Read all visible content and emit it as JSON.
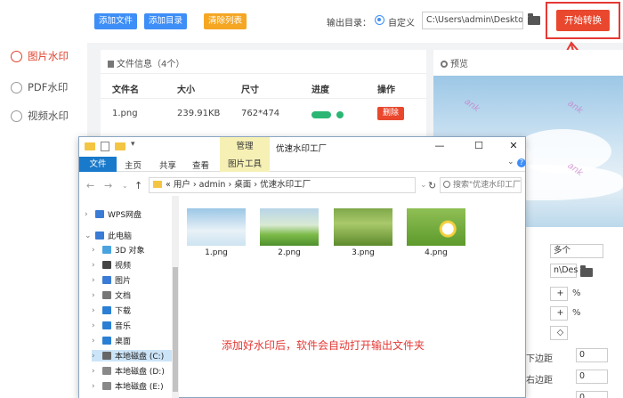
{
  "nav": {
    "items": [
      {
        "label": "图片水印",
        "active": true
      },
      {
        "label": "PDF水印",
        "active": false
      },
      {
        "label": "视频水印",
        "active": false
      }
    ]
  },
  "toolbar": {
    "add_file": "添加文件",
    "add_dir": "添加目录",
    "clear_list": "清除列表",
    "output_label": "输出目录：",
    "custom_label": "自定义",
    "output_path": "C:\\Users\\admin\\Deskto",
    "start_button": "开始转换"
  },
  "file_panel": {
    "title": "文件信息（4个）",
    "headers": [
      "文件名",
      "大小",
      "尺寸",
      "进度",
      "操作"
    ],
    "rows": [
      {
        "name": "1.png",
        "size": "239.91KB",
        "dimensions": "762*474",
        "action": "删除"
      }
    ]
  },
  "preview": {
    "title": "预览",
    "watermark_text": "ank",
    "count_value": "多个",
    "path_value": "n\\Des",
    "percent1": "%",
    "percent2": "%",
    "margin_label1": "下边距",
    "margin_label2": "右边距",
    "zero1": "0",
    "zero2": "0",
    "zero3": "0"
  },
  "explorer": {
    "manage_tab": "管理",
    "title": "优速水印工厂",
    "ribbon_tabs": [
      "文件",
      "主页",
      "共享",
      "查看"
    ],
    "picture_tools": "图片工具",
    "address": "«  用户  ›  admin  ›  桌面  ›  优速水印工厂",
    "search_placeholder": "搜索\"优速水印工厂\"",
    "tree": [
      {
        "label": "WPS网盘",
        "icon": "cloud-icon"
      },
      {
        "label": "此电脑",
        "icon": "pc-icon"
      },
      {
        "label": "3D 对象",
        "icon": "cube-icon"
      },
      {
        "label": "视频",
        "icon": "video-icon"
      },
      {
        "label": "图片",
        "icon": "image-icon"
      },
      {
        "label": "文档",
        "icon": "doc-icon"
      },
      {
        "label": "下载",
        "icon": "download-icon"
      },
      {
        "label": "音乐",
        "icon": "music-icon"
      },
      {
        "label": "桌面",
        "icon": "desktop-icon"
      },
      {
        "label": "本地磁盘 (C:)",
        "icon": "drive-icon"
      },
      {
        "label": "本地磁盘 (D:)",
        "icon": "drive-icon"
      },
      {
        "label": "本地磁盘 (E:)",
        "icon": "drive-icon"
      }
    ],
    "files": [
      "1.png",
      "2.png",
      "3.png",
      "4.png"
    ],
    "notice": "添加好水印后，软件会自动打开输出文件夹"
  },
  "colors": {
    "accent_red": "#e9482e",
    "accent_blue": "#3e8ef7",
    "accent_orange": "#f5a623",
    "progress_green": "#2bb673",
    "annotation_red": "#e53935"
  }
}
